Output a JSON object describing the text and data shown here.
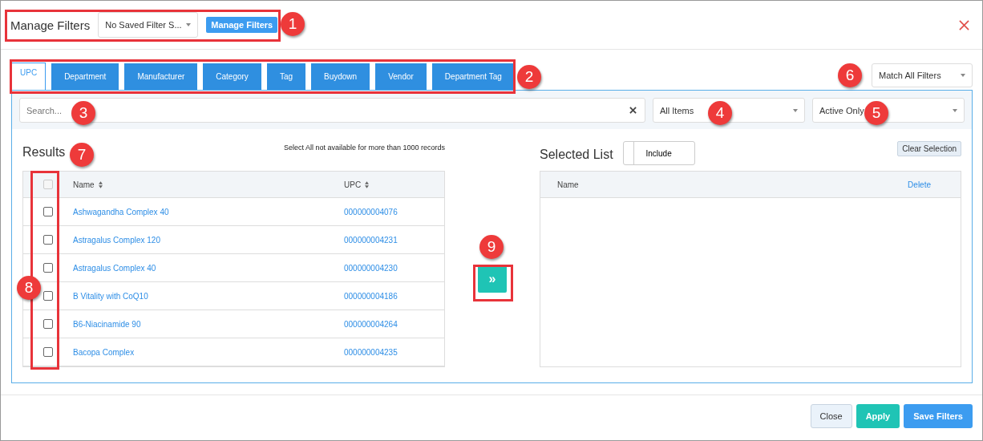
{
  "header": {
    "title": "Manage Filters",
    "saved_filter": {
      "value": "No Saved Filter S..."
    },
    "manage_button": "Manage Filters"
  },
  "tabs": [
    {
      "label": "UPC",
      "selected": true
    },
    {
      "label": "Department",
      "selected": false
    },
    {
      "label": "Manufacturer",
      "selected": false
    },
    {
      "label": "Category",
      "selected": false
    },
    {
      "label": "Tag",
      "selected": false
    },
    {
      "label": "Buydown",
      "selected": false
    },
    {
      "label": "Vendor",
      "selected": false
    },
    {
      "label": "Department Tag",
      "selected": false
    }
  ],
  "match_mode": {
    "value": "Match All Filters"
  },
  "search": {
    "placeholder": "Search..."
  },
  "item_filter": {
    "value": "All Items"
  },
  "status_filter": {
    "value": "Active Only"
  },
  "results": {
    "title": "Results",
    "note": "Select All not available for more than 1000 records",
    "select_all": {
      "checked": false,
      "disabled": true
    },
    "columns": [
      "Name",
      "UPC"
    ],
    "rows": [
      {
        "name": "Ashwagandha Complex 40",
        "upc": "000000004076",
        "checked": false
      },
      {
        "name": "Astragalus Complex 120",
        "upc": "000000004231",
        "checked": false
      },
      {
        "name": "Astragalus Complex 40",
        "upc": "000000004230",
        "checked": false
      },
      {
        "name": "B Vitality with CoQ10",
        "upc": "000000004186",
        "checked": false
      },
      {
        "name": "B6-Niacinamide 90",
        "upc": "000000004264",
        "checked": false
      },
      {
        "name": "Bacopa Complex",
        "upc": "000000004235",
        "checked": false
      }
    ]
  },
  "move_button": "»",
  "selected_list": {
    "title": "Selected List",
    "mode": {
      "label": "Include",
      "on": false
    },
    "clear_button": "Clear Selection",
    "columns": [
      "Name",
      "Delete"
    ]
  },
  "footer": {
    "buttons": [
      {
        "label": "Close",
        "kind": "default"
      },
      {
        "label": "Apply",
        "kind": "success"
      },
      {
        "label": "Save Filters",
        "kind": "primary"
      }
    ]
  },
  "callouts": [
    "1",
    "2",
    "3",
    "4",
    "5",
    "6",
    "7",
    "8",
    "9"
  ]
}
